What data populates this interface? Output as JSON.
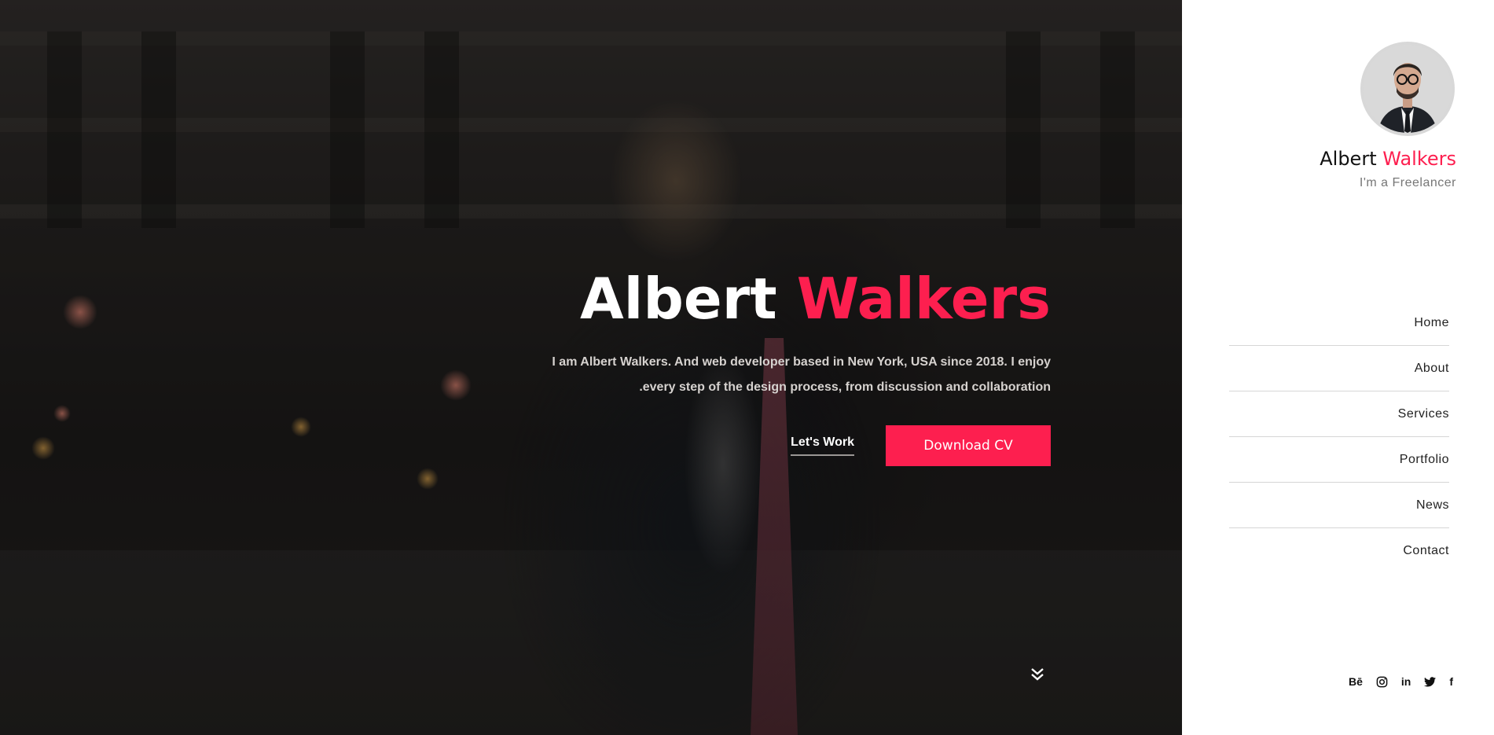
{
  "hero": {
    "title_first": "Albert",
    "title_last": "Walkers",
    "description_line1": "I am Albert Walkers. And web developer based in New York, USA since 2018. I enjoy",
    "description_line2": ".every step of the design process, from discussion and collaboration",
    "lets_work_label": "Let's Work",
    "download_label": "Download CV",
    "scroll_icon": "double-chevron-down-icon"
  },
  "sidebar": {
    "name_first": "Albert",
    "name_last": "Walkers",
    "role": "I'm a Freelancer",
    "nav": [
      {
        "label": "Home"
      },
      {
        "label": "About"
      },
      {
        "label": "Services"
      },
      {
        "label": "Portfolio"
      },
      {
        "label": "News"
      },
      {
        "label": "Contact"
      }
    ],
    "socials": [
      {
        "label": "Bē",
        "icon": "behance-icon"
      },
      {
        "label": "",
        "icon": "instagram-icon"
      },
      {
        "label": "in",
        "icon": "linkedin-icon"
      },
      {
        "label": "",
        "icon": "twitter-icon"
      },
      {
        "label": "f",
        "icon": "facebook-icon"
      }
    ]
  },
  "colors": {
    "accent": "#fd1f4f",
    "sidebar_bg": "#ffffff",
    "hero_text": "#ffffff"
  }
}
